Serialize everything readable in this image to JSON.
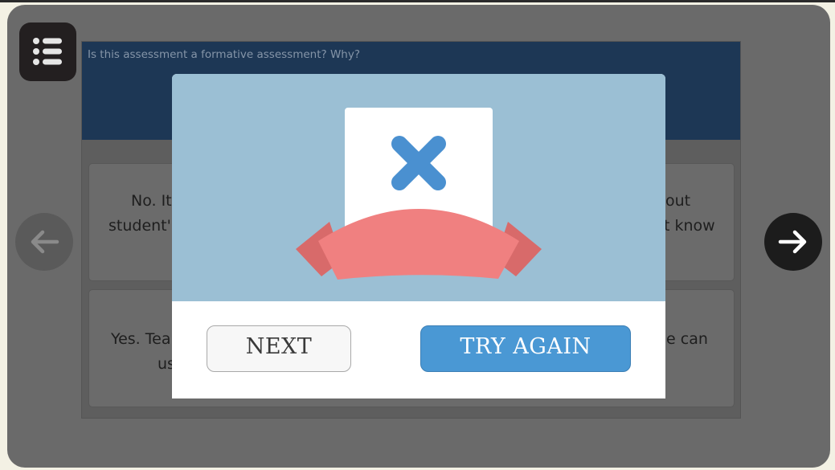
{
  "question": {
    "text": "Is this assessment a formative assessment? Why?"
  },
  "answers": [
    {
      "left_visible": "No. It",
      "left_visible_2": "student'",
      "right_visible": "out",
      "right_visible_2": "t know"
    },
    {
      "left_visible": "Yes. Tea",
      "left_visible_2": "us",
      "right_visible": "he can"
    }
  ],
  "feedback_modal": {
    "result_icon": "wrong-x-icon",
    "next_label": "NEXT",
    "try_again_label": "TRY  AGAIN"
  },
  "icons": {
    "menu": "list-menu-icon",
    "prev": "arrow-left-icon",
    "next": "arrow-right-icon"
  },
  "colors": {
    "x_mark": "#4a90d0",
    "ribbon": "#f08080",
    "modal_art_bg": "#9bbfd4",
    "try_again_button": "#4a98d4",
    "question_header": "#1d3755"
  }
}
